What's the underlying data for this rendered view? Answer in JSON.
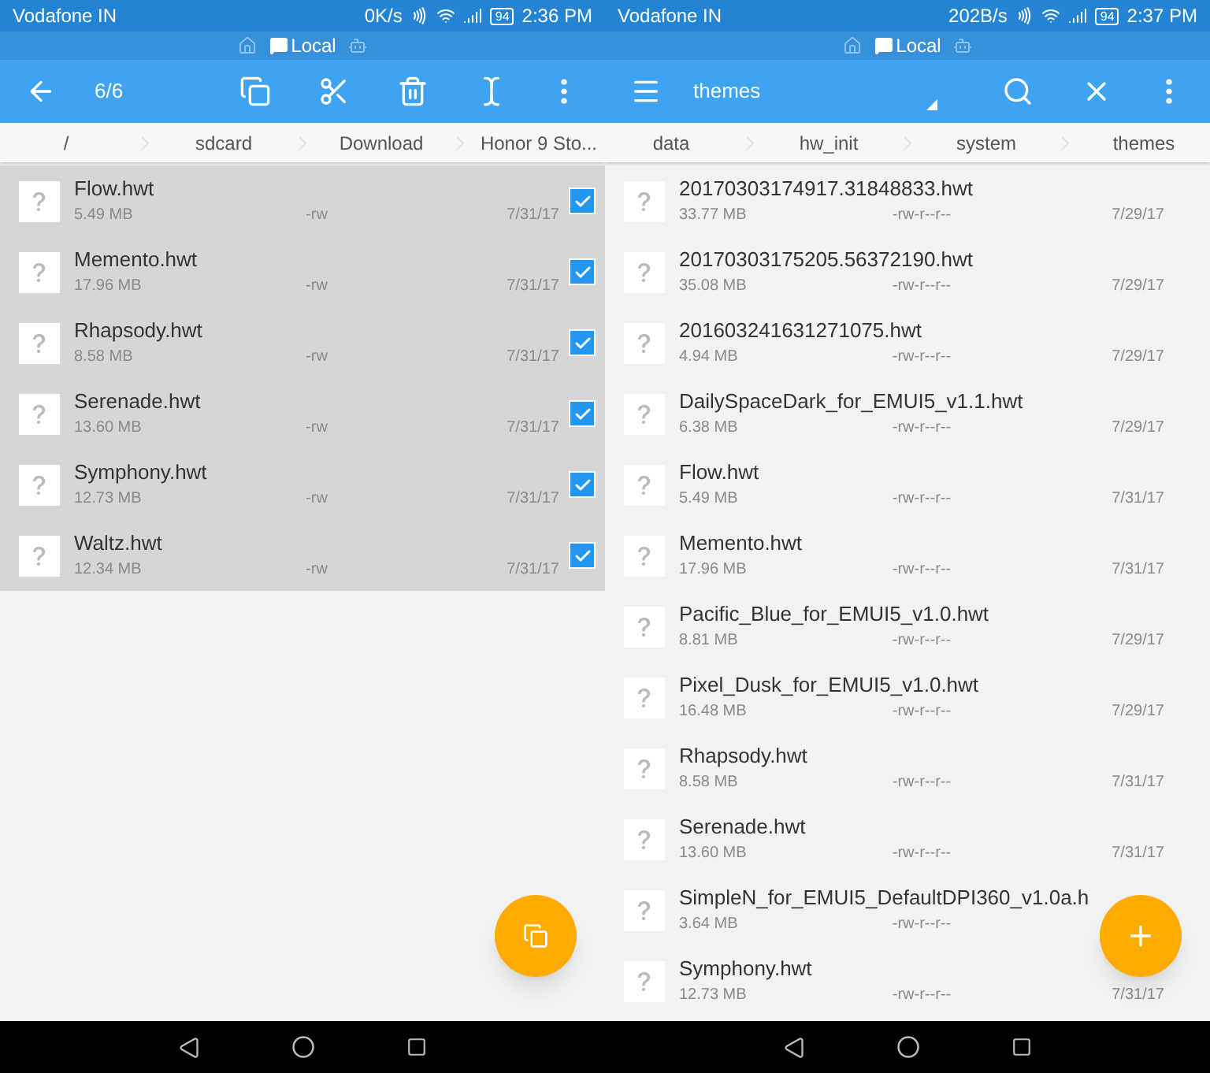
{
  "screens": [
    {
      "status_bar": {
        "carrier": "Vodafone IN",
        "speed": "0K/s",
        "battery": "94",
        "time": "2:36 PM"
      },
      "location_bar": {
        "label": "Local"
      },
      "toolbar": {
        "kind": "selection",
        "title": "6/6"
      },
      "breadcrumbs": [
        "/",
        "sdcard",
        "Download",
        "Honor 9 Sto..."
      ],
      "files": [
        {
          "name": "Flow.hwt",
          "size": "5.49 MB",
          "permissions": "-rw",
          "date": "7/31/17",
          "selected": true
        },
        {
          "name": "Memento.hwt",
          "size": "17.96 MB",
          "permissions": "-rw",
          "date": "7/31/17",
          "selected": true
        },
        {
          "name": "Rhapsody.hwt",
          "size": "8.58 MB",
          "permissions": "-rw",
          "date": "7/31/17",
          "selected": true
        },
        {
          "name": "Serenade.hwt",
          "size": "13.60 MB",
          "permissions": "-rw",
          "date": "7/31/17",
          "selected": true
        },
        {
          "name": "Symphony.hwt",
          "size": "12.73 MB",
          "permissions": "-rw",
          "date": "7/31/17",
          "selected": true
        },
        {
          "name": "Waltz.hwt",
          "size": "12.34 MB",
          "permissions": "-rw",
          "date": "7/31/17",
          "selected": true
        }
      ],
      "fab": {
        "kind": "copy"
      }
    },
    {
      "status_bar": {
        "carrier": "Vodafone IN",
        "speed": "202B/s",
        "battery": "94",
        "time": "2:37 PM"
      },
      "location_bar": {
        "label": "Local"
      },
      "toolbar": {
        "kind": "browse",
        "title": "themes"
      },
      "breadcrumbs": [
        "data",
        "hw_init",
        "system",
        "themes"
      ],
      "files": [
        {
          "name": "20170303174917.31848833.hwt",
          "size": "33.77 MB",
          "permissions": "-rw-r--r--",
          "date": "7/29/17",
          "selected": false
        },
        {
          "name": "20170303175205.56372190.hwt",
          "size": "35.08 MB",
          "permissions": "-rw-r--r--",
          "date": "7/29/17",
          "selected": false
        },
        {
          "name": "201603241631271075.hwt",
          "size": "4.94 MB",
          "permissions": "-rw-r--r--",
          "date": "7/29/17",
          "selected": false
        },
        {
          "name": "DailySpaceDark_for_EMUI5_v1.1.hwt",
          "size": "6.38 MB",
          "permissions": "-rw-r--r--",
          "date": "7/29/17",
          "selected": false
        },
        {
          "name": "Flow.hwt",
          "size": "5.49 MB",
          "permissions": "-rw-r--r--",
          "date": "7/31/17",
          "selected": false
        },
        {
          "name": "Memento.hwt",
          "size": "17.96 MB",
          "permissions": "-rw-r--r--",
          "date": "7/31/17",
          "selected": false
        },
        {
          "name": "Pacific_Blue_for_EMUI5_v1.0.hwt",
          "size": "8.81 MB",
          "permissions": "-rw-r--r--",
          "date": "7/29/17",
          "selected": false
        },
        {
          "name": "Pixel_Dusk_for_EMUI5_v1.0.hwt",
          "size": "16.48 MB",
          "permissions": "-rw-r--r--",
          "date": "7/29/17",
          "selected": false
        },
        {
          "name": "Rhapsody.hwt",
          "size": "8.58 MB",
          "permissions": "-rw-r--r--",
          "date": "7/31/17",
          "selected": false
        },
        {
          "name": "Serenade.hwt",
          "size": "13.60 MB",
          "permissions": "-rw-r--r--",
          "date": "7/31/17",
          "selected": false
        },
        {
          "name": "SimpleN_for_EMUI5_DefaultDPI360_v1.0a.h",
          "size": "3.64 MB",
          "permissions": "-rw-r--r--",
          "selected": false
        },
        {
          "name": "Symphony.hwt",
          "size": "12.73 MB",
          "permissions": "-rw-r--r--",
          "date": "7/31/17",
          "selected": false
        }
      ],
      "fab": {
        "kind": "add"
      }
    }
  ]
}
